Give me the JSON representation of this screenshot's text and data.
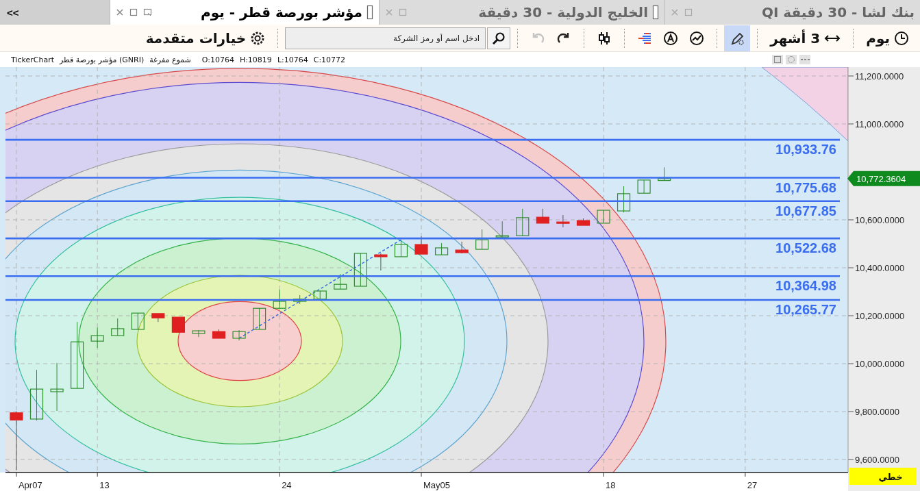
{
  "tab_bar": {
    "collapse_button": "<<"
  },
  "tabs": [
    {
      "label": "QI بنك لشا - 30 دقيقة",
      "selected": false,
      "marker": false
    },
    {
      "label": "الخليج الدولية - 30 دقيقة",
      "selected": false,
      "marker": true
    },
    {
      "label": "مؤشر بورصة قطر - يوم",
      "selected": true,
      "marker": true
    }
  ],
  "toolbar": {
    "period": "يوم",
    "range": "3 أشهر",
    "tools": [
      {
        "kind": "drawing",
        "selected": true
      },
      {
        "kind": "chart_type",
        "selected": false
      },
      {
        "kind": "alert",
        "selected": false
      },
      {
        "kind": "levels",
        "selected": false
      },
      {
        "kind": "candles",
        "selected": false
      }
    ],
    "history": [
      {
        "kind": "redo",
        "disabled": false
      },
      {
        "kind": "undo",
        "disabled": true
      }
    ],
    "search": {
      "placeholder": "ادخل اسم أو رمز الشركة"
    },
    "advanced_options": "خيارات متقدمة"
  },
  "info_bar": {
    "source": "TickerChart",
    "symbol": "مؤشر بورصة قطر (GNRI)",
    "style": "شموع مفرغة",
    "open": "O:10764",
    "high": "H:10819",
    "low": "L:10764",
    "close": "C:10772"
  },
  "chart": {
    "y_axis_labels": [
      "11,200.0000",
      "11,000.0000",
      "10,600.0000",
      "10,400.0000",
      "10,200.0000",
      "10,000.0000",
      "9,800.0000",
      "9,600.0000"
    ],
    "x_axis_labels": [
      "27",
      "18",
      "May05",
      "24",
      "13",
      "Apr07"
    ],
    "levels": [
      "10,933.76",
      "10,775.68",
      "10,677.85",
      "10,522.68",
      "10,364.98",
      "10,265.77"
    ],
    "last_price": "10,772.3604",
    "scale_type": "خطي"
  }
}
